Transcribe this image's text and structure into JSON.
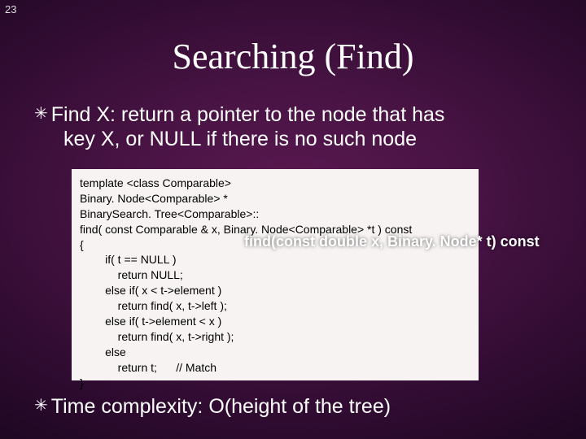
{
  "page_number": "23",
  "title": "Searching (Find)",
  "bullet1": {
    "icon": "✳",
    "line1": "Find X: return a pointer to the node that has",
    "line2": "key X, or NULL if there is no such node"
  },
  "code": "template <class Comparable>\nBinary. Node<Comparable> *\nBinarySearch. Tree<Comparable>::\nfind( const Comparable & x, Binary. Node<Comparable> *t ) const\n{\n        if( t == NULL )\n            return NULL;\n        else if( x < t->element )\n            return find( x, t->left );\n        else if( t->element < x )\n            return find( x, t->right );\n        else\n            return t;      // Match\n}",
  "overlay": "find(const double x, Binary. Node* t) const",
  "bullet2": {
    "icon": "✳",
    "text": "Time complexity: O(height of the tree)"
  }
}
